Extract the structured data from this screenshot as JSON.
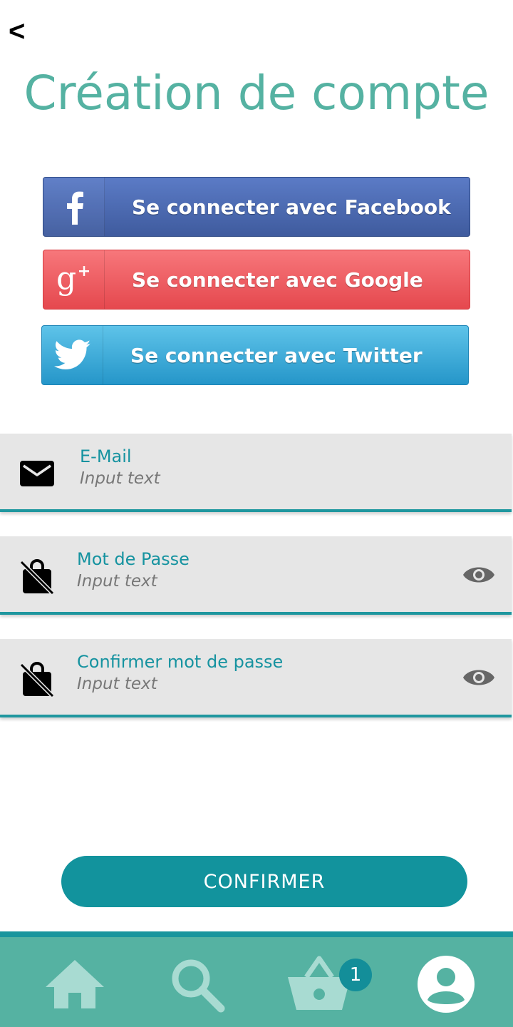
{
  "header": {
    "back_label": "<",
    "title": "Création de compte"
  },
  "social": {
    "facebook_label": "Se connecter avec Facebook",
    "google_label": "Se connecter avec Google",
    "twitter_label": "Se connecter avec Twitter",
    "facebook_color": "#4a67ad",
    "google_color": "#ef5d62",
    "twitter_color": "#3aacdb"
  },
  "form": {
    "email": {
      "label": "E-Mail",
      "placeholder": "Input text"
    },
    "password": {
      "label": "Mot de Passe",
      "placeholder": "Input text"
    },
    "confirm_password": {
      "label": "Confirmer mot de passe",
      "placeholder": "Input text"
    }
  },
  "confirm_button": {
    "label": "CONFIRMER"
  },
  "bottom_nav": {
    "items": [
      {
        "icon": "home-icon"
      },
      {
        "icon": "search-icon"
      },
      {
        "icon": "basket-icon"
      },
      {
        "icon": "account-icon"
      }
    ],
    "cart_badge": "1"
  },
  "colors": {
    "accent": "#55b2a2",
    "primary": "#12939d",
    "field_bg": "#e6e6e6"
  }
}
